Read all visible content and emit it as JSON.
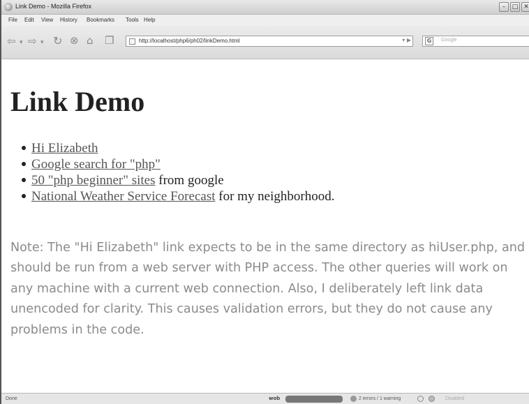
{
  "window": {
    "title": "Link Demo - Mozilla Firefox",
    "controls": {
      "minimize": "–",
      "maximize": "□",
      "close": "✕"
    }
  },
  "menu": [
    "File",
    "Edit",
    "View",
    "History",
    "Bookmarks",
    "Tools",
    "Help"
  ],
  "nav": {
    "url": "http://localhost/php6/ph02/linkDemo.html",
    "search_engine": "G",
    "search_placeholder": "Google",
    "icons": [
      "back-icon",
      "forward-icon",
      "reload-icon",
      "stop-icon",
      "home-icon",
      "bookmark-icon"
    ]
  },
  "page": {
    "heading": "Link Demo",
    "links": [
      {
        "link_text": "Hi Elizabeth",
        "suffix": ""
      },
      {
        "link_text": "Google search for \"php\"",
        "suffix": ""
      },
      {
        "link_text": "50 \"php beginner\" sites",
        "suffix": " from google"
      },
      {
        "link_text": "National Weather Service Forecast",
        "suffix": " for my neighborhood."
      }
    ],
    "note": "Note: The \"Hi Elizabeth\" link expects to be in the same directory as hiUser.php, and should be run from a web server with PHP access. The other queries will work on any machine with a current web connection. Also, I deliberately left link data unencoded for clarity. This causes validation errors, but they do not cause any problems in the code."
  },
  "status": {
    "text": "Done",
    "webdev_label": "wob",
    "errors": "2 errors / 1 warning",
    "disabled": "Disabled"
  },
  "colors": {
    "link": "#555555",
    "note": "#8b8b8b",
    "heading": "#222222"
  }
}
